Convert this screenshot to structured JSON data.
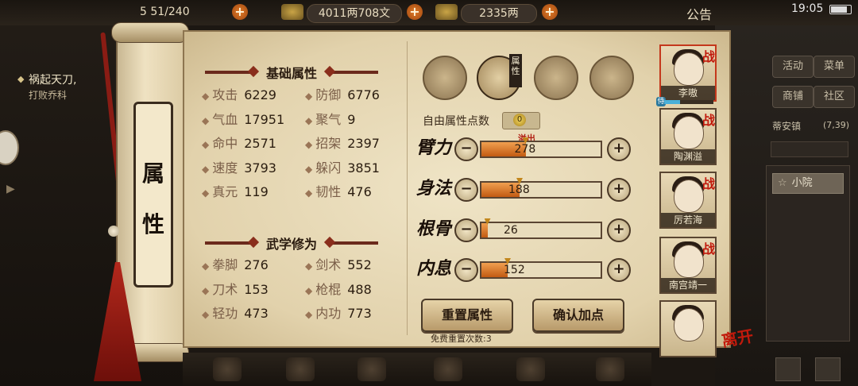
{
  "topbar": {
    "capacity": "5 51/240",
    "silver": "4011两708文",
    "gold": "2335两",
    "notice": "公告",
    "time": "19:05"
  },
  "quest": {
    "title": "祸起天刀,",
    "subtitle": "打败乔科"
  },
  "scroll": {
    "label_top": "属",
    "label_bottom": "性"
  },
  "base": {
    "title": "基础属性",
    "stats": [
      {
        "label": "攻击",
        "value": "6229"
      },
      {
        "label": "防御",
        "value": "6776"
      },
      {
        "label": "气血",
        "value": "17951"
      },
      {
        "label": "聚气",
        "value": "9"
      },
      {
        "label": "命中",
        "value": "2571"
      },
      {
        "label": "招架",
        "value": "2397"
      },
      {
        "label": "速度",
        "value": "3793"
      },
      {
        "label": "躲闪",
        "value": "3851"
      },
      {
        "label": "真元",
        "value": "119"
      },
      {
        "label": "韧性",
        "value": "476"
      }
    ]
  },
  "martial": {
    "title": "武学修为",
    "stats": [
      {
        "label": "拳脚",
        "value": "276"
      },
      {
        "label": "剑术",
        "value": "552"
      },
      {
        "label": "刀术",
        "value": "153"
      },
      {
        "label": "枪棍",
        "value": "488"
      },
      {
        "label": "轻功",
        "value": "473"
      },
      {
        "label": "内功",
        "value": "773"
      }
    ]
  },
  "tabs": {
    "active_label": "属性",
    "icons": [
      "hat-icon",
      "scroll-icon",
      "bagua-icon",
      "body-icon"
    ]
  },
  "free_points": {
    "label": "自由属性点数",
    "value": "0"
  },
  "attributes": {
    "overflow_label": "溢出",
    "items": [
      {
        "name": "臂力",
        "value": "278",
        "fill": 0.37
      },
      {
        "name": "身法",
        "value": "188",
        "fill": 0.32
      },
      {
        "name": "根骨",
        "value": "26",
        "fill": 0.05
      },
      {
        "name": "内息",
        "value": "152",
        "fill": 0.22
      }
    ]
  },
  "buttons": {
    "reset": "重置属性",
    "confirm": "确认加点",
    "reset_note": "免费重置次数:3"
  },
  "characters": [
    {
      "name": "李嗷",
      "war": "战"
    },
    {
      "name": "陶渊溢",
      "war": "战"
    },
    {
      "name": "厉若海",
      "war": "战"
    },
    {
      "name": "南宫靖一",
      "war": "战"
    },
    {
      "name": ""
    }
  ],
  "leave_badge": "离开",
  "wu_tag": "侍",
  "sidebar": {
    "activity": "活动",
    "menu": "菜单",
    "shop": "商铺",
    "community": "社区",
    "location": "蒂安镇",
    "coords": "(7,39)",
    "room": "小院"
  }
}
